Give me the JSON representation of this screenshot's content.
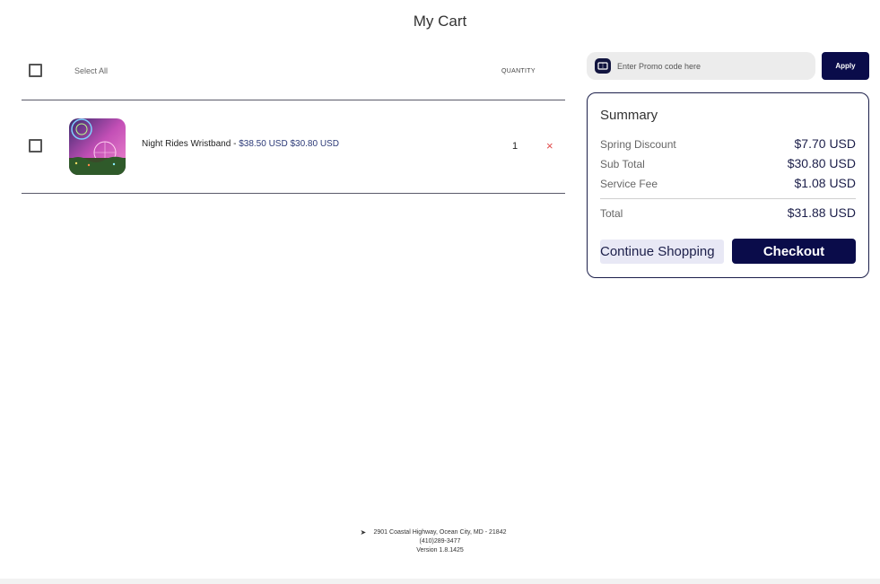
{
  "page_title": "My Cart",
  "cart": {
    "select_all_label": "Select All",
    "quantity_header": "QUANTITY",
    "items": [
      {
        "name": "Night Rides Wristband",
        "separator": " - ",
        "price_text": "$38.50 USD $30.80 USD",
        "quantity": "1",
        "remove_icon": "×"
      }
    ]
  },
  "promo": {
    "placeholder": "Enter Promo code here",
    "apply_label": "Apply",
    "icon": "ticket-icon"
  },
  "summary": {
    "title": "Summary",
    "rows": [
      {
        "label": "Spring Discount",
        "value": "$7.70 USD"
      },
      {
        "label": "Sub Total",
        "value": "$30.80 USD"
      },
      {
        "label": "Service Fee",
        "value": "$1.08 USD"
      }
    ],
    "total": {
      "label": "Total",
      "value": "$31.88 USD"
    },
    "continue_label": "Continue Shopping",
    "checkout_label": "Checkout"
  },
  "footer": {
    "address": "2901 Coastal Highway, Ocean City, MD - 21842",
    "phone": "(410)289-3477",
    "version": "Version 1.8.1425",
    "icon": "location-pin-icon"
  },
  "colors": {
    "brand_navy": "#0a0c4a",
    "remove_red": "#e04848",
    "price_blue": "#2c3a78"
  }
}
